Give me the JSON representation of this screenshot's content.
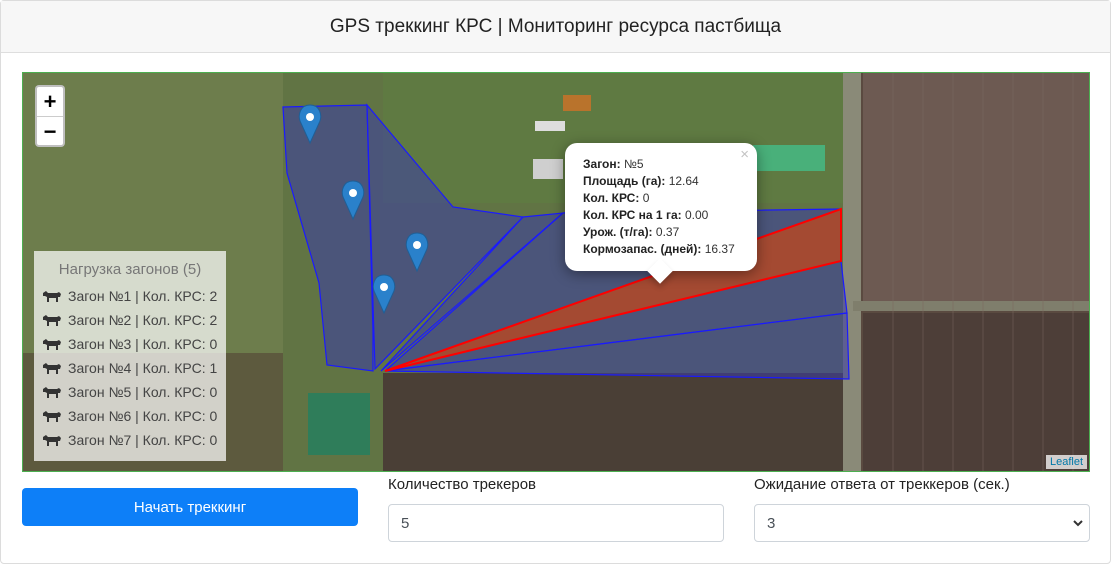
{
  "header": {
    "title": "GPS треккинг КРС | Мониторинг ресурса пастбища"
  },
  "map": {
    "zoom_in": "+",
    "zoom_out": "−",
    "attribution": "Leaflet",
    "legend": {
      "title": "Нагрузка загонов (5)",
      "items": [
        "Загон №1 | Кол. КРС: 2",
        "Загон №2 | Кол. КРС: 2",
        "Загон №3 | Кол. КРС: 0",
        "Загон №4 | Кол. КРС: 1",
        "Загон №5 | Кол. КРС: 0",
        "Загон №6 | Кол. КРС: 0",
        "Загон №7 | Кол. КРС: 0"
      ]
    },
    "popup": {
      "close": "×",
      "rows": [
        {
          "label": "Загон:",
          "value": "№5"
        },
        {
          "label": "Площадь (га):",
          "value": "12.64"
        },
        {
          "label": "Кол. КРС:",
          "value": "0"
        },
        {
          "label": "Кол. КРС на 1 га:",
          "value": "0.00"
        },
        {
          "label": "Урож. (т/га):",
          "value": "0.37"
        },
        {
          "label": "Кормозапас. (дней):",
          "value": "16.37"
        }
      ]
    },
    "colors": {
      "paddock_fill": "#3a3ca8",
      "paddock_stroke": "#1a1aff",
      "selected_fill": "#c0392b",
      "selected_stroke": "#ff0000",
      "marker": "#2a81cb"
    }
  },
  "controls": {
    "start_button": "Начать треккинг",
    "trackers_label": "Количество трекеров",
    "trackers_value": "5",
    "wait_label": "Ожидание ответа от треккеров (сек.)",
    "wait_value": "3"
  }
}
